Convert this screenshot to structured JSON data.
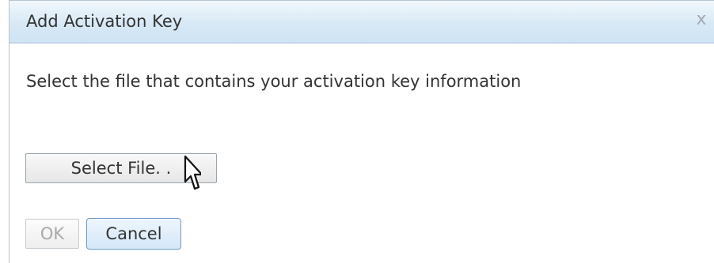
{
  "dialog": {
    "title": "Add Activation Key",
    "close_icon": "close-icon",
    "close_glyph": "x",
    "message": "Select the file that contains your activation key information",
    "select_file_label": "Select File. .",
    "ok_label": "OK",
    "cancel_label": "Cancel"
  },
  "colors": {
    "titlebar": "#d7e9f6",
    "text": "#333333",
    "disabled_text": "#a9a9a9",
    "focus_border": "#6f9ac4"
  },
  "icons": {
    "cursor": "mouse-pointer-icon"
  }
}
